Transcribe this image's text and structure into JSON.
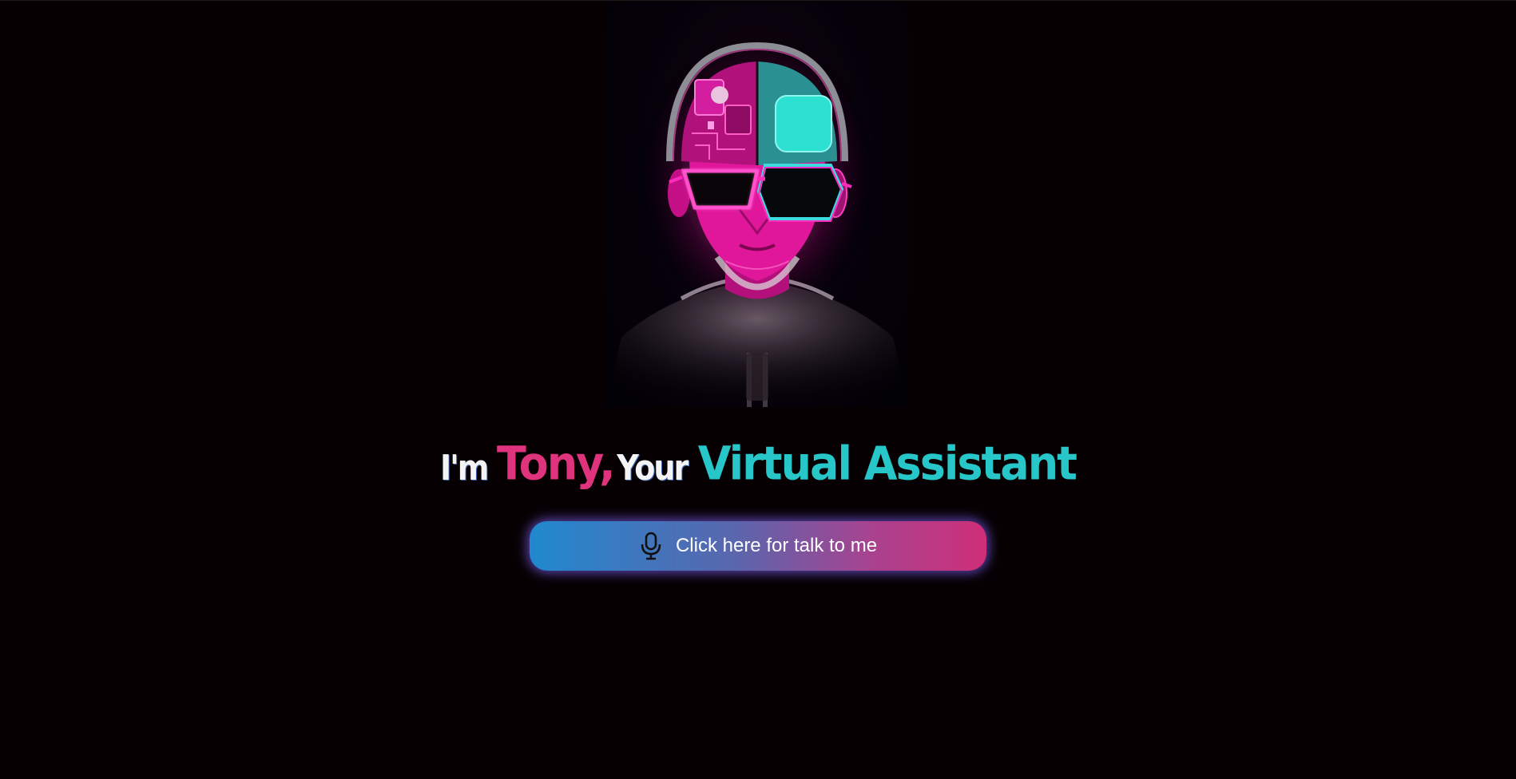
{
  "hero": {
    "avatar_icon": "cyberpunk-robot-avatar",
    "colors": {
      "magenta": "#ff1aa8",
      "cyan": "#2ce0d2"
    }
  },
  "headline": {
    "intro": "I'm",
    "name": "Tony,",
    "connector": "Your",
    "role": "Virtual Assistant",
    "colors": {
      "intro": "#f4f4f4",
      "name": "#e0337e",
      "role": "#27c6c8"
    }
  },
  "talk_button": {
    "icon": "microphone-icon",
    "label": "Click here for talk to me",
    "gradient": [
      "#2189cf",
      "#cf2f78"
    ]
  }
}
